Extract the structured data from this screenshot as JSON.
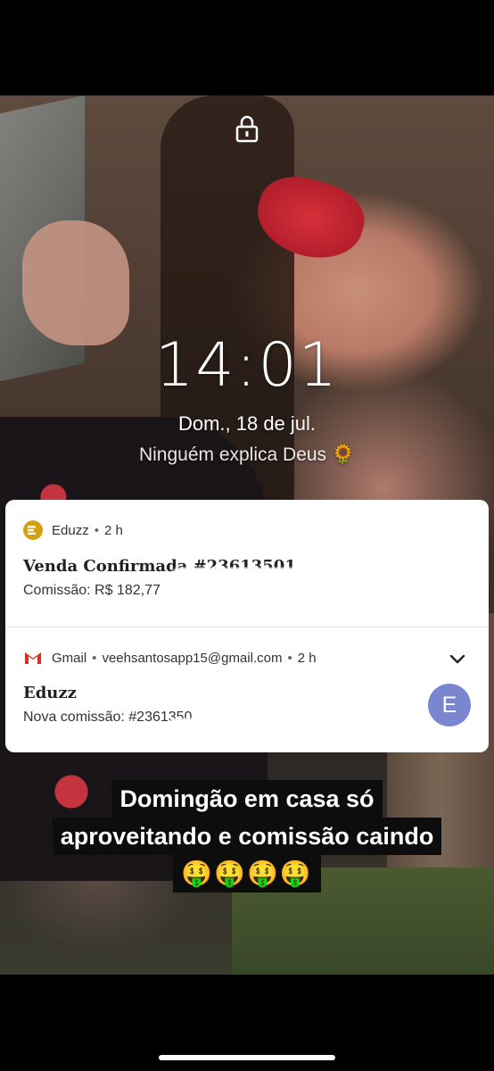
{
  "lockscreen": {
    "time": "14:01",
    "date": "Dom., 18 de jul.",
    "owner_info": "Ninguém explica Deus 🌻"
  },
  "notifications": [
    {
      "app": "Eduzz",
      "time_ago": "2 h",
      "title": "Venda Confirmada #23613501",
      "text": "Comissão: R$ 182,77"
    },
    {
      "app": "Gmail",
      "account": "veehsantosapp15@gmail.com",
      "time_ago": "2 h",
      "title": "Eduzz",
      "text": "Nova comissão: #2361350",
      "avatar_letter": "E",
      "avatar_color": "#7b86d0"
    }
  ],
  "caption": {
    "line1": "Domingão em casa só",
    "line2": "aproveitando e comissão caindo",
    "emoji": "🤑🤑🤑🤑"
  },
  "colors": {
    "eduzz_brand": "#d4a015",
    "gmail_red": "#d93025",
    "caption_bg": "#0d0d0d"
  }
}
